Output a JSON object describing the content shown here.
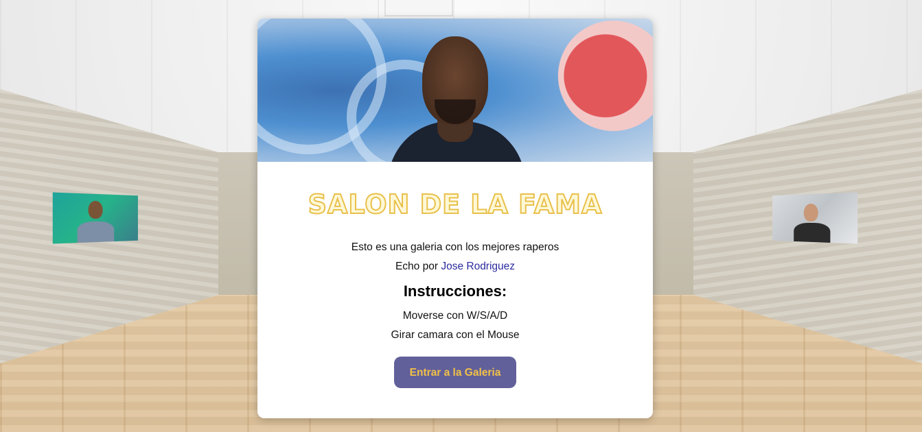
{
  "modal": {
    "title": "SALON DE LA FAMA",
    "description": "Esto es una galeria con los mejores raperos",
    "credit_prefix": "Echo por",
    "credit_author": "Jose Rodriguez",
    "instructions_heading": "Instrucciones:",
    "instructions": [
      "Moverse con W/S/A/D",
      "Girar camara con el Mouse"
    ],
    "enter_button_label": "Entrar a la Galeria"
  },
  "colors": {
    "title_outline": "#e8c04b",
    "button_bg": "#62609a",
    "button_text": "#f1c148",
    "link": "#2b2b9e"
  }
}
